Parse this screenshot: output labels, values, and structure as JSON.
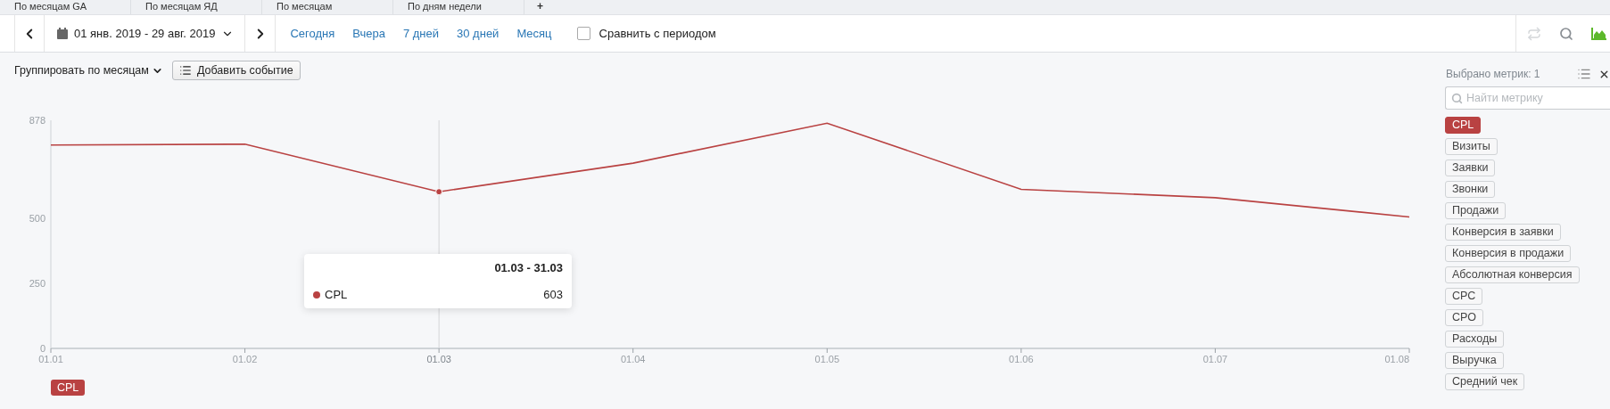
{
  "tabs": [
    {
      "label": "По месяцам GA",
      "selected": false
    },
    {
      "label": "По месяцам ЯД",
      "selected": false
    },
    {
      "label": "По месяцам",
      "selected": false
    },
    {
      "label": "По дням недели",
      "selected": false
    }
  ],
  "add_tab": "+",
  "toolbar": {
    "date_range": "01 янв. 2019 - 29 авг. 2019",
    "quick_periods": [
      "Сегодня",
      "Вчера",
      "7 дней",
      "30 дней",
      "Месяц"
    ],
    "compare": {
      "label": "Сравнить с периодом",
      "checked": false
    },
    "tools": [
      {
        "kind": "repeat",
        "disabled": true,
        "selected": false
      },
      {
        "kind": "search",
        "disabled": false,
        "selected": false
      },
      {
        "kind": "chart",
        "disabled": false,
        "selected": true
      }
    ]
  },
  "group_by": "Группировать по месяцам",
  "add_event": "Добавить событие",
  "chart": {
    "chart_data": {
      "type": "line",
      "categories": [
        "01.01",
        "01.02",
        "01.03",
        "01.04",
        "01.05",
        "01.06",
        "01.07",
        "01.08"
      ],
      "series": [
        {
          "name": "CPL",
          "color": "#b94242",
          "values": [
            783,
            786,
            603,
            713,
            867,
            612,
            580,
            506
          ]
        }
      ],
      "ylim": [
        0,
        878
      ],
      "yticks": [
        0,
        250,
        500,
        878
      ]
    },
    "points": [
      {
        "selected": false
      },
      {
        "selected": false
      },
      {
        "selected": true
      },
      {
        "selected": false
      },
      {
        "selected": false
      },
      {
        "selected": false
      },
      {
        "selected": false
      },
      {
        "selected": false
      }
    ],
    "tooltip": {
      "title": "01.03 - 31.03",
      "series": "CPL",
      "value": "603"
    }
  },
  "metrics_panel": {
    "count": "Выбрано метрик: 1",
    "search_placeholder": "Найти метрику",
    "metrics": [
      {
        "label": "CPL",
        "selected": true
      },
      {
        "label": "Визиты",
        "selected": false
      },
      {
        "label": "Заявки",
        "selected": false
      },
      {
        "label": "Звонки",
        "selected": false
      },
      {
        "label": "Продажи",
        "selected": false
      },
      {
        "label": "Конверсия в заявки",
        "selected": false
      },
      {
        "label": "Конверсия в продажи",
        "selected": false
      },
      {
        "label": "Абсолютная конверсия",
        "selected": false
      },
      {
        "label": "CPC",
        "selected": false
      },
      {
        "label": "CPO",
        "selected": false
      },
      {
        "label": "Расходы",
        "selected": false
      },
      {
        "label": "Выручка",
        "selected": false
      },
      {
        "label": "Средний чек",
        "selected": false
      }
    ]
  }
}
